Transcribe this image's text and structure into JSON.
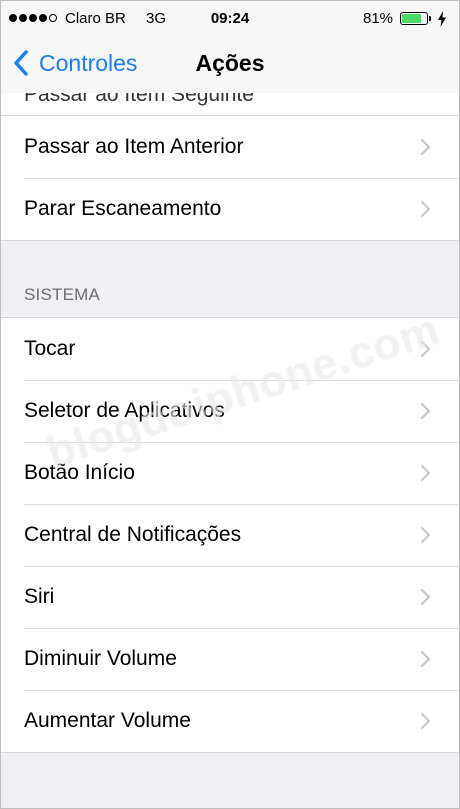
{
  "status_bar": {
    "signal_dots": [
      true,
      true,
      true,
      true,
      false
    ],
    "carrier": "Claro BR",
    "network": "3G",
    "time": "09:24",
    "battery_percent": "81%",
    "battery_level": 0.81,
    "battery_color": "#4cd964"
  },
  "nav": {
    "back_label": "Controles",
    "title": "Ações",
    "accent_color": "#1a7ef5"
  },
  "partial_item": {
    "label": "Passar ao Item Seguinte"
  },
  "top_items": [
    {
      "label": "Passar ao Item Anterior"
    },
    {
      "label": "Parar Escaneamento"
    }
  ],
  "section_header": "SISTEMA",
  "system_items": [
    {
      "label": "Tocar"
    },
    {
      "label": "Seletor de Aplicativos"
    },
    {
      "label": "Botão Início"
    },
    {
      "label": "Central de Notificações"
    },
    {
      "label": "Siri"
    },
    {
      "label": "Diminuir Volume"
    },
    {
      "label": "Aumentar Volume"
    }
  ],
  "watermark": "blogdoiphone.com"
}
